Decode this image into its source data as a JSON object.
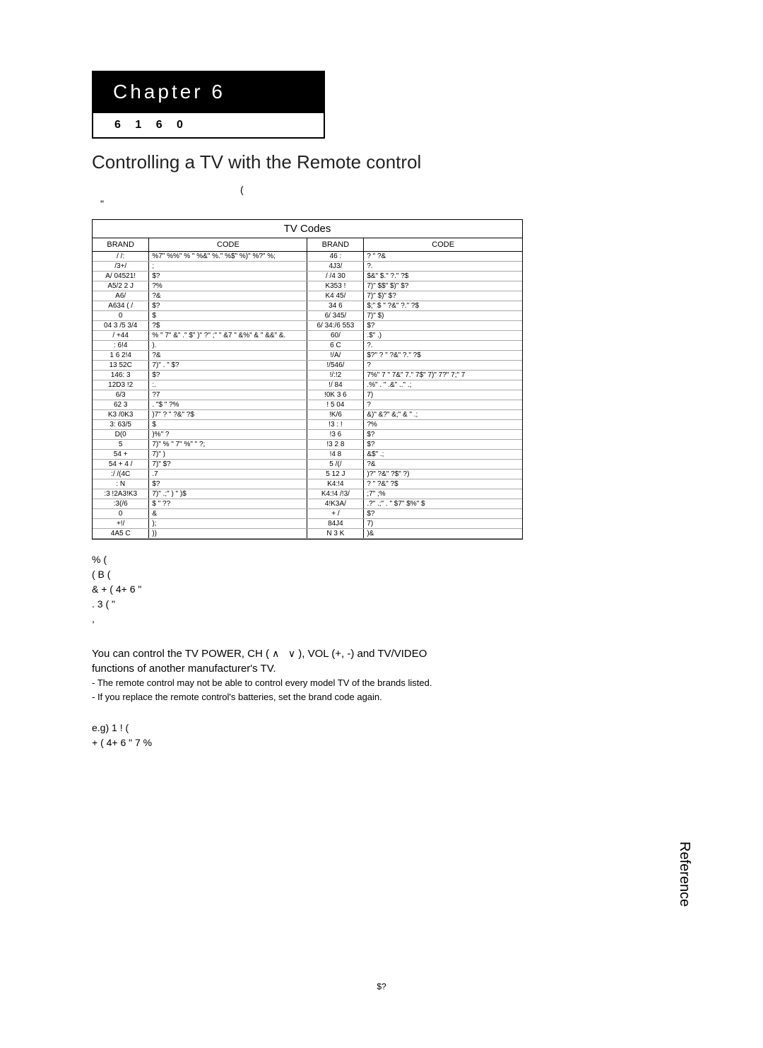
{
  "chapter": {
    "label": "Chapter 6",
    "sub": "6 1 6 0"
  },
  "pageTitle": "Controlling a TV with the Remote control",
  "intro": {
    "line1": "(",
    "line2": "\""
  },
  "codesHeader": "TV Codes",
  "tableHeaders": {
    "brand": "BRAND",
    "code": "CODE"
  },
  "codesLeft": [
    {
      "brand": "/ /:",
      "code": "%7\" %%\" % \" %&\" %.\" %$\" %)\" %?\" %;"
    },
    {
      "brand": "/3+/",
      "code": ";"
    },
    {
      "brand": "A/ 04521!",
      "code": "$?"
    },
    {
      "brand": "A5/2 2 J",
      "code": "?%"
    },
    {
      "brand": "A6/",
      "code": "?&"
    },
    {
      "brand": "A634 ( /",
      "code": "$?"
    },
    {
      "brand": "0",
      "code": "$"
    },
    {
      "brand": "04 3 /5 3/4",
      "code": "?$"
    },
    {
      "brand": "/ +44",
      "code": "% \" 7\" &\" .\" $\" )\" ?\" ;\" \"\n&7 \" &%\" & \" &&\" &."
    },
    {
      "brand": ": 6!4",
      "code": ")."
    },
    {
      "brand": "1 6 2!4",
      "code": "?&"
    },
    {
      "brand": "13 52C",
      "code": "7)\" . \" $?"
    },
    {
      "brand": "146: 3",
      "code": "$?"
    },
    {
      "brand": "12D3 !2",
      "code": ":."
    },
    {
      "brand": "6/3",
      "code": "?7"
    },
    {
      "brand": "62 3",
      "code": ". \"$ \" ?%"
    },
    {
      "brand": "K3 /0K3",
      "code": ")7\" ? \" ?&\" ?$"
    },
    {
      "brand": "3: 63/5",
      "code": "$"
    },
    {
      "brand": "D(0",
      "code": ")%\" ?"
    },
    {
      "brand": "5",
      "code": "7)\" % \" 7\" %\"  \" ?;"
    },
    {
      "brand": "54 +",
      "code": "7)\" )"
    },
    {
      "brand": "54 + 4 /",
      "code": "7)\" $?"
    },
    {
      "brand": ":/ /(4C",
      "code": ".7"
    },
    {
      "brand": ": N",
      "code": "$?"
    },
    {
      "brand": ":3 !2A3!K3",
      "code": "7)\" .;\" ) \" )$"
    },
    {
      "brand": ":3(/6",
      "code": "$ \" ??"
    },
    {
      "brand": "0",
      "code": "&"
    },
    {
      "brand": "+!/",
      "code": ");"
    },
    {
      "brand": "4A5 C",
      "code": "))"
    }
  ],
  "codesRight": [
    {
      "brand": "46 :",
      "code": "? \" ?&"
    },
    {
      "brand": "4J3/",
      "code": "?."
    },
    {
      "brand": "/ /4 30",
      "code": "$&\" $.\" ?.\" ?$"
    },
    {
      "brand": "K353 !",
      "code": "7)\" $$\" $)\" $?"
    },
    {
      "brand": "K4 45/",
      "code": "7)\" $)\" $?"
    },
    {
      "brand": "34 6",
      "code": "$;\" $ \" ?&\" ?.\" ?$"
    },
    {
      "brand": "6/ 345/",
      "code": "7)\" $)"
    },
    {
      "brand": "6/ 34:/6 553",
      "code": "$?"
    },
    {
      "brand": "60/",
      "code": ".$\" .)"
    },
    {
      "brand": "6 C",
      "code": "?."
    },
    {
      "brand": "!/A/",
      "code": "$?\" ? \" ?&\" ?.\" ?$"
    },
    {
      "brand": "!/546/",
      "code": "?"
    },
    {
      "brand": "!/:!2",
      "code": "7%\" 7 \" 7&\" 7.\" 7$\" 7)\" 7?\" 7;\" 7"
    },
    {
      "brand": "!/ 84",
      "code": ".%\" . \" .&\" ..\" .;"
    },
    {
      "brand": "!0K 3 6",
      "code": "7)"
    },
    {
      "brand": "! 5 04",
      "code": "?"
    },
    {
      "brand": "!K/6",
      "code": "&)\" &?\" &;\" & \" .;"
    },
    {
      "brand": "!3 : !",
      "code": "?%"
    },
    {
      "brand": "!3 6",
      "code": "$?"
    },
    {
      "brand": "!3 2 8",
      "code": "$?"
    },
    {
      "brand": "!4 8",
      "code": "&$\" .;"
    },
    {
      "brand": "5 /(/",
      "code": "?&"
    },
    {
      "brand": "5 12 J",
      "code": ")?\" ?&\" ?$\" ?)"
    },
    {
      "brand": "K4:!4",
      "code": "? \" ?&\" ?$"
    },
    {
      "brand": "K4:!4 /!3/",
      "code": ";7\" ;%"
    },
    {
      "brand": "4!K3A/",
      "code": ".?\" .;\" . \" $7\" $%\" $"
    },
    {
      "brand": "+ /",
      "code": "$?"
    },
    {
      "brand": "84J4",
      "code": "7)"
    },
    {
      "brand": "N 3 K",
      "code": ")&"
    }
  ],
  "steps": {
    "line1": "%         (",
    "line2": "     ( B             (",
    "line3": "& +          ( 4+ 6           \"",
    "line4": ".  3     (             \"",
    "line5": "               ,"
  },
  "controlNote": {
    "main1": "You can control the TV POWER, CH (",
    "main2": "), VOL (+, -) and TV/VIDEO",
    "main3": "functions of another manufacturer's TV.",
    "sub1": "- The remote control may not be able to control every model TV of the brands listed.",
    "sub2": "- If you replace the remote control's batteries, set the brand code again."
  },
  "example": {
    "line1": "e.g) 1   !      (",
    "line2": "+              ( 4+ 6    \"   7          %"
  },
  "sideTab": "Reference",
  "pageNum": "$?"
}
